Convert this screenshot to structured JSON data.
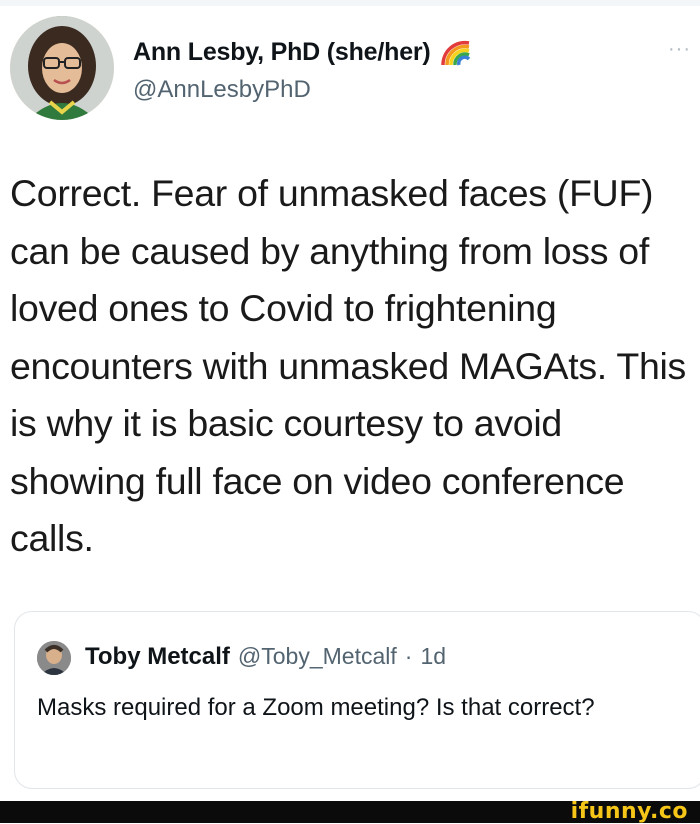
{
  "tweet": {
    "display_name": "Ann Lesby, PhD (she/her)",
    "handle": "@AnnLesbyPhD",
    "more": "···",
    "text": "Correct. Fear of unmasked faces (FUF) can be caused by anything from loss of loved ones to Covid to frightening encounters with unmasked MAGAts. This is why it is basic courtesy to avoid showing full face on video conference calls."
  },
  "quoted": {
    "display_name": "Toby Metcalf",
    "handle": "@Toby_Metcalf",
    "separator": "·",
    "time": "1d",
    "text": "Masks required for a Zoom meeting? Is that correct?"
  },
  "watermark": "ifunny.co",
  "colors": {
    "text": "#0f1419",
    "secondary": "#536471",
    "watermark": "#f5c518",
    "bar": "#0b0b0b"
  }
}
